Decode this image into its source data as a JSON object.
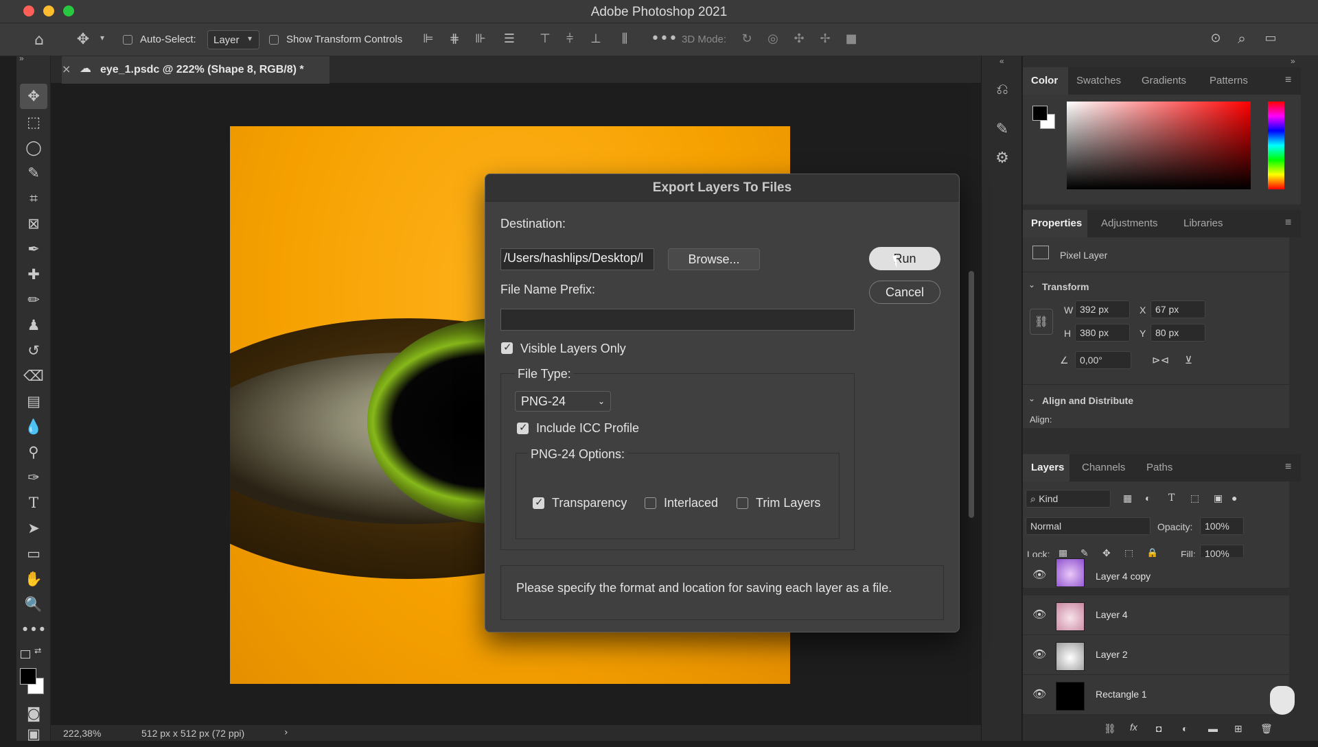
{
  "app": {
    "title": "Adobe Photoshop 2021"
  },
  "options_bar": {
    "auto_select_label": "Auto-Select:",
    "auto_select_value": "Layer",
    "show_transform_label": "Show Transform Controls",
    "mode_3d_label": "3D Mode:"
  },
  "document": {
    "tab_title": "eye_1.psdc @ 222% (Shape 8, RGB/8) *",
    "zoom": "222,38%",
    "doc_info": "512 px x 512 px (72 ppi)"
  },
  "color_panel": {
    "tabs": [
      "Color",
      "Swatches",
      "Gradients",
      "Patterns"
    ],
    "active_tab": "Color"
  },
  "properties_panel": {
    "tabs": [
      "Properties",
      "Adjustments",
      "Libraries"
    ],
    "layer_kind": "Pixel Layer",
    "transform_heading": "Transform",
    "w_label": "W",
    "w_value": "392 px",
    "h_label": "H",
    "h_value": "380 px",
    "x_label": "X",
    "x_value": "67 px",
    "y_label": "Y",
    "y_value": "80 px",
    "angle_value": "0,00°",
    "align_heading": "Align and Distribute",
    "align_label": "Align:"
  },
  "layers_panel": {
    "tabs": [
      "Layers",
      "Channels",
      "Paths"
    ],
    "filter_kind": "Kind",
    "blend_mode": "Normal",
    "opacity_label": "Opacity:",
    "opacity_value": "100%",
    "lock_label": "Lock:",
    "fill_label": "Fill:",
    "fill_value": "100%",
    "layers": [
      {
        "name": "Layer 4 copy"
      },
      {
        "name": "Layer 4"
      },
      {
        "name": "Layer 2"
      },
      {
        "name": "Rectangle 1"
      }
    ]
  },
  "dialog": {
    "title": "Export Layers To Files",
    "destination_label": "Destination:",
    "destination_value": "/Users/hashlips/Desktop/l",
    "browse_label": "Browse...",
    "run_label": "Run",
    "cancel_label": "Cancel",
    "prefix_label": "File Name Prefix:",
    "prefix_value": "",
    "visible_only_label": "Visible Layers Only",
    "visible_only_checked": true,
    "file_type_label": "File Type:",
    "file_type_value": "PNG-24",
    "icc_label": "Include ICC Profile",
    "icc_checked": true,
    "png_options_label": "PNG-24 Options:",
    "transparency_label": "Transparency",
    "transparency_checked": true,
    "interlaced_label": "Interlaced",
    "interlaced_checked": false,
    "trim_label": "Trim Layers",
    "trim_checked": false,
    "help_text": "Please specify the format and location for saving each layer as a file."
  }
}
